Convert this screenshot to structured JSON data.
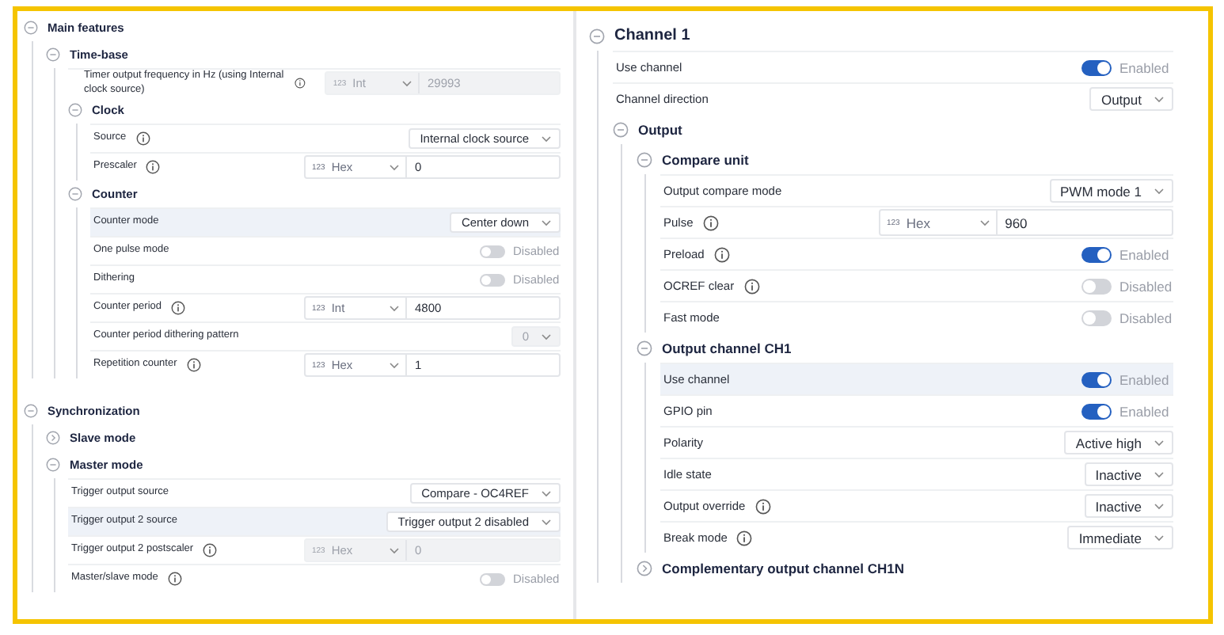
{
  "panels": [
    {
      "nodes": [
        {
          "title": "Main features",
          "expanded": true,
          "children": [
            {
              "title": "Time-base",
              "expanded": true,
              "rows": [
                {
                  "kind": "number",
                  "label": "Timer output frequency in Hz (using Internal clock source)",
                  "info": true,
                  "badge": "123",
                  "format": "Int",
                  "value": "29993",
                  "disabled": true,
                  "selected": false
                }
              ],
              "children": [
                {
                  "title": "Clock",
                  "expanded": true,
                  "rows": [
                    {
                      "kind": "select",
                      "label": "Source",
                      "info": true,
                      "value": "Internal clock source",
                      "disabled": false,
                      "selected": false
                    },
                    {
                      "kind": "number",
                      "label": "Prescaler",
                      "info": true,
                      "badge": "123",
                      "format": "Hex",
                      "value": "0",
                      "disabled": false,
                      "selected": false
                    }
                  ]
                },
                {
                  "title": "Counter",
                  "expanded": true,
                  "rows": [
                    {
                      "kind": "select",
                      "label": "Counter mode",
                      "info": false,
                      "value": "Center down",
                      "disabled": false,
                      "selected": true
                    },
                    {
                      "kind": "toggle",
                      "label": "One pulse mode",
                      "info": false,
                      "on": false,
                      "value": "Disabled",
                      "selected": false
                    },
                    {
                      "kind": "toggle",
                      "label": "Dithering",
                      "info": false,
                      "on": false,
                      "value": "Disabled",
                      "selected": false
                    },
                    {
                      "kind": "number",
                      "label": "Counter period",
                      "info": true,
                      "badge": "123",
                      "format": "Int",
                      "value": "4800",
                      "disabled": false,
                      "selected": false
                    },
                    {
                      "kind": "select",
                      "label": "Counter period dithering pattern",
                      "info": false,
                      "value": "0",
                      "disabled": true,
                      "selected": false
                    },
                    {
                      "kind": "number",
                      "label": "Repetition counter",
                      "info": true,
                      "badge": "123",
                      "format": "Hex",
                      "value": "1",
                      "disabled": false,
                      "selected": false
                    }
                  ]
                }
              ]
            }
          ]
        },
        {
          "title": "Synchronization",
          "expanded": true,
          "children": [
            {
              "title": "Slave mode",
              "expanded": false
            },
            {
              "title": "Master mode",
              "expanded": true,
              "rows": [
                {
                  "kind": "select",
                  "label": "Trigger output source",
                  "info": false,
                  "value": "Compare - OC4REF",
                  "disabled": false,
                  "selected": false
                },
                {
                  "kind": "select",
                  "label": "Trigger output 2 source",
                  "info": false,
                  "value": "Trigger output 2 disabled",
                  "disabled": false,
                  "selected": true
                },
                {
                  "kind": "number",
                  "label": "Trigger output 2 postscaler",
                  "info": true,
                  "badge": "123",
                  "format": "Hex",
                  "value": "0",
                  "disabled": true,
                  "selected": false
                },
                {
                  "kind": "toggle",
                  "label": "Master/slave mode",
                  "info": true,
                  "on": false,
                  "value": "Disabled",
                  "selected": false
                }
              ]
            }
          ]
        }
      ]
    },
    {
      "nodes": [
        {
          "title": "Channel 1",
          "expanded": true,
          "rows": [
            {
              "kind": "toggle",
              "label": "Use channel",
              "info": false,
              "on": true,
              "value": "Enabled",
              "selected": false
            },
            {
              "kind": "select",
              "label": "Channel direction",
              "info": false,
              "value": "Output",
              "disabled": false,
              "selected": false
            }
          ],
          "children": [
            {
              "title": "Output",
              "expanded": true,
              "children": [
                {
                  "title": "Compare unit",
                  "expanded": true,
                  "rows": [
                    {
                      "kind": "select",
                      "label": "Output compare mode",
                      "info": false,
                      "value": "PWM mode 1",
                      "disabled": false,
                      "selected": false
                    },
                    {
                      "kind": "number",
                      "label": "Pulse",
                      "info": true,
                      "badge": "123",
                      "format": "Hex",
                      "value": "960",
                      "disabled": false,
                      "selected": false
                    },
                    {
                      "kind": "toggle",
                      "label": "Preload",
                      "info": true,
                      "on": true,
                      "value": "Enabled",
                      "selected": false
                    },
                    {
                      "kind": "toggle",
                      "label": "OCREF clear",
                      "info": true,
                      "on": false,
                      "value": "Disabled",
                      "selected": false
                    },
                    {
                      "kind": "toggle",
                      "label": "Fast mode",
                      "info": false,
                      "on": false,
                      "value": "Disabled",
                      "selected": false
                    }
                  ]
                },
                {
                  "title": "Output channel CH1",
                  "expanded": true,
                  "rows": [
                    {
                      "kind": "toggle",
                      "label": "Use channel",
                      "info": false,
                      "on": true,
                      "value": "Enabled",
                      "selected": true
                    },
                    {
                      "kind": "toggle",
                      "label": "GPIO pin",
                      "info": false,
                      "on": true,
                      "value": "Enabled",
                      "selected": false
                    },
                    {
                      "kind": "select",
                      "label": "Polarity",
                      "info": false,
                      "value": "Active high",
                      "disabled": false,
                      "selected": false
                    },
                    {
                      "kind": "select",
                      "label": "Idle state",
                      "info": false,
                      "value": "Inactive",
                      "disabled": false,
                      "selected": false
                    },
                    {
                      "kind": "select",
                      "label": "Output override",
                      "info": true,
                      "value": "Inactive",
                      "disabled": false,
                      "selected": false
                    },
                    {
                      "kind": "select",
                      "label": "Break mode",
                      "info": true,
                      "value": "Immediate",
                      "disabled": false,
                      "selected": false
                    }
                  ]
                },
                {
                  "title": "Complementary output channel CH1N",
                  "expanded": false
                }
              ]
            }
          ]
        }
      ]
    }
  ]
}
